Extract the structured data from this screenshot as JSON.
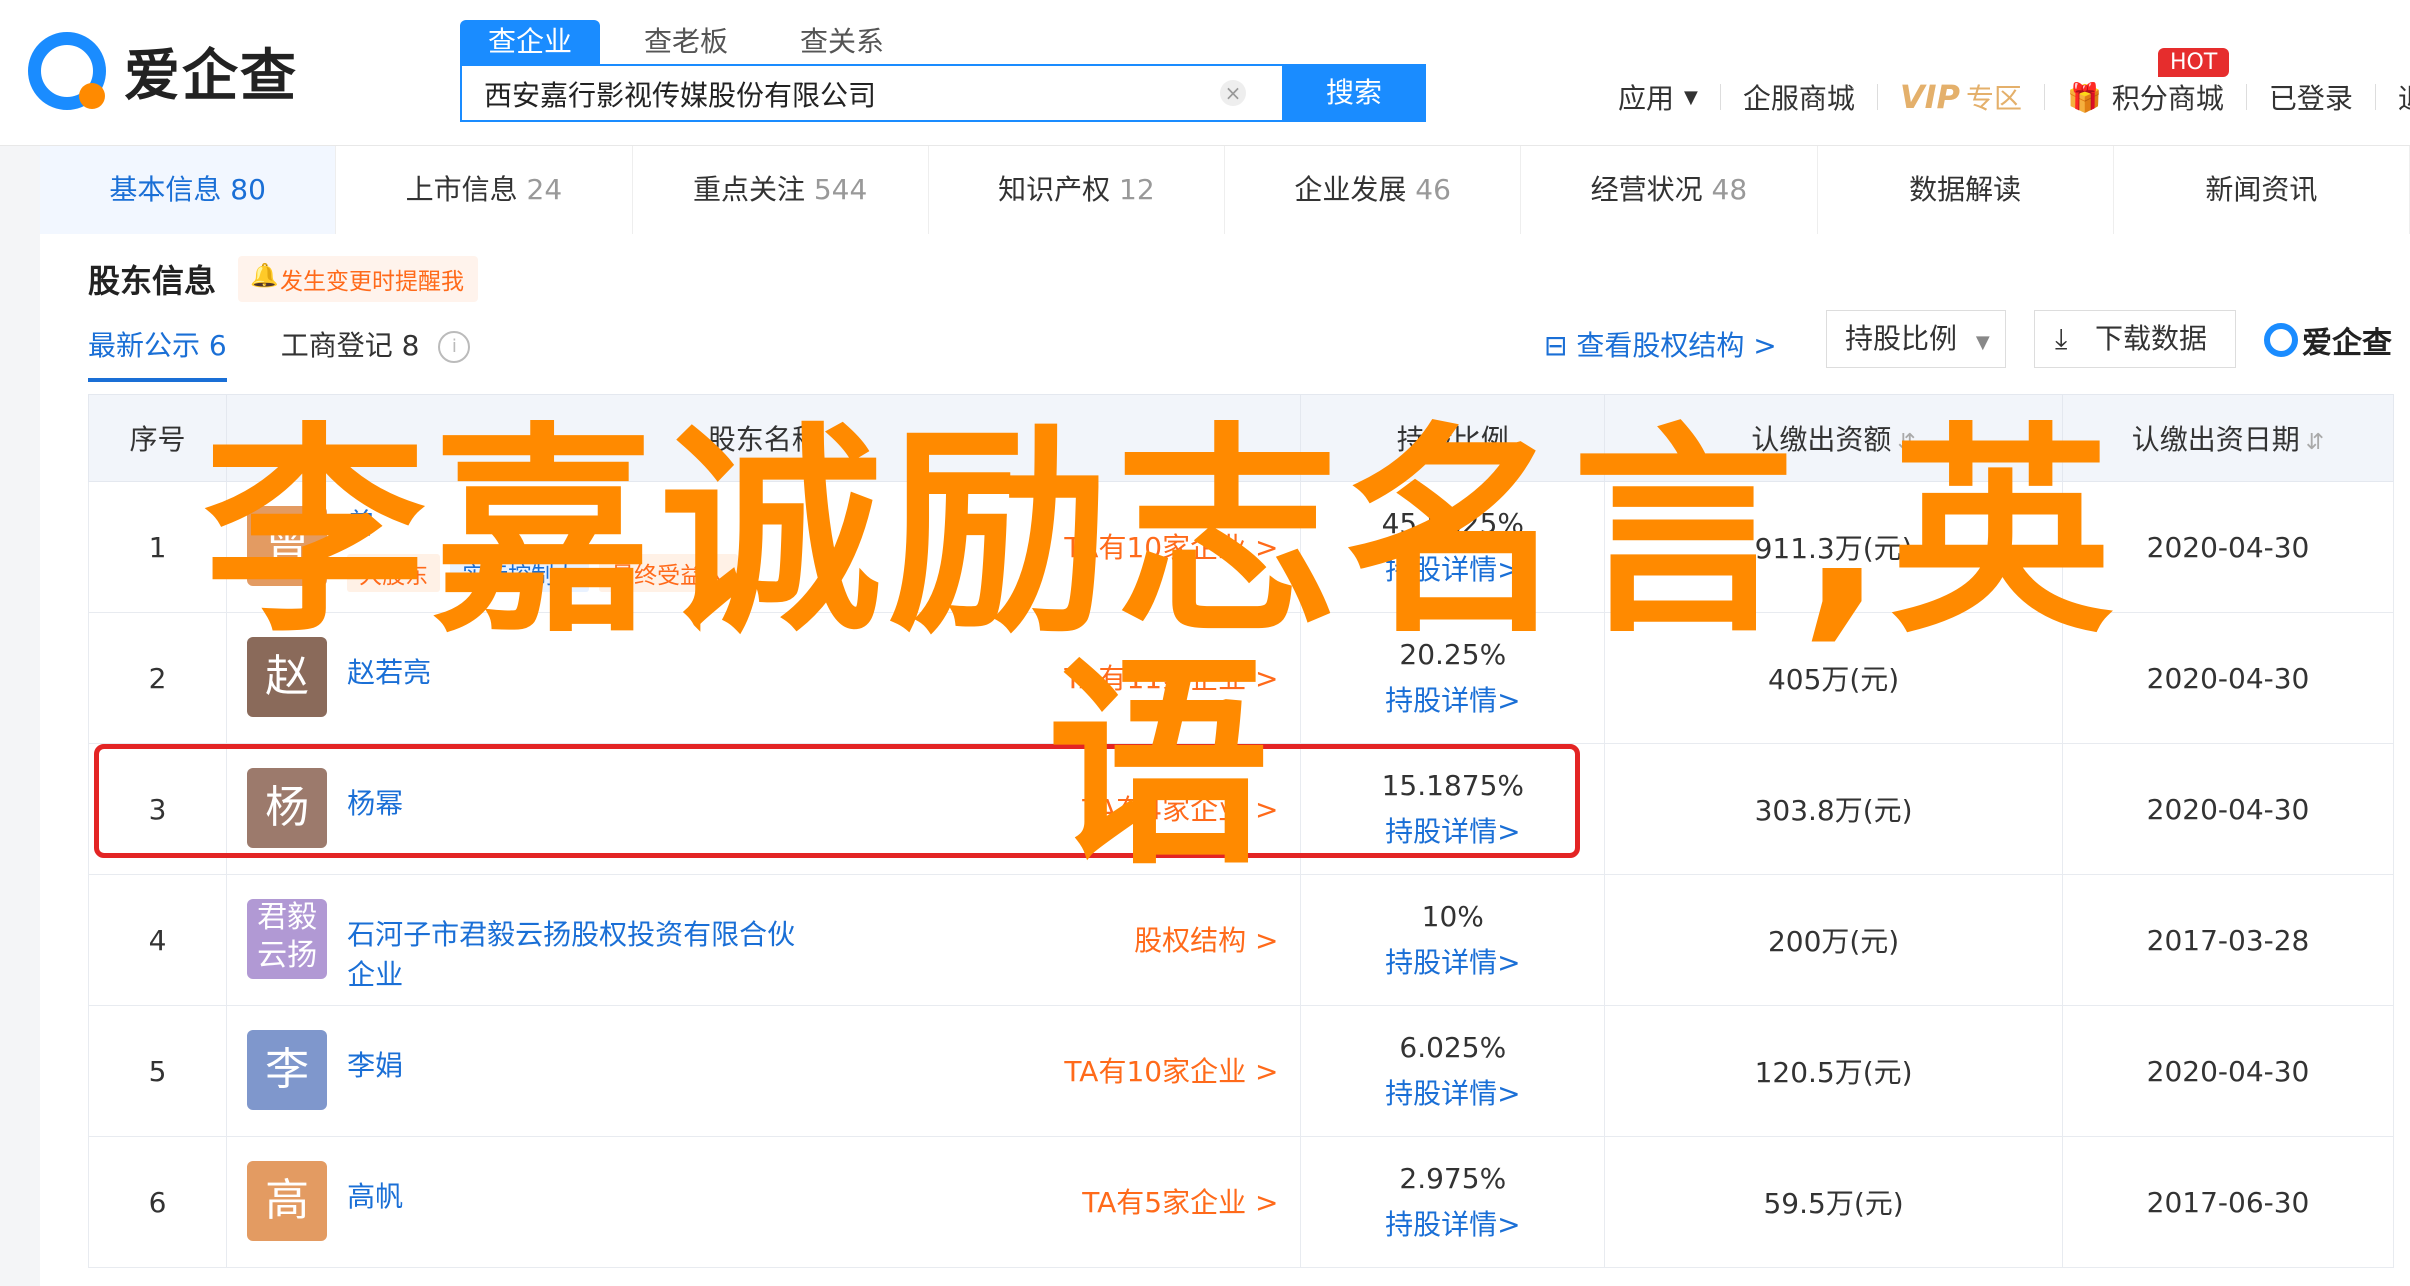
{
  "header": {
    "logo_text": "爱企查",
    "search_tabs": [
      "查企业",
      "查老板",
      "查关系"
    ],
    "search_value": "西安嘉行影视传媒股份有限公司",
    "clear_icon": "×",
    "search_button": "搜索",
    "nav": {
      "apps": "应用",
      "services": "企服商城",
      "vip": "VIP",
      "vip_zone": "专区",
      "points": "积分商城",
      "hot_badge": "HOT",
      "user": "已登录",
      "logout": "退出"
    }
  },
  "category_tabs": [
    {
      "label": "基本信息",
      "count": "80"
    },
    {
      "label": "上市信息",
      "count": "24"
    },
    {
      "label": "重点关注",
      "count": "544"
    },
    {
      "label": "知识产权",
      "count": "12"
    },
    {
      "label": "企业发展",
      "count": "46"
    },
    {
      "label": "经营状况",
      "count": "48"
    },
    {
      "label": "数据解读",
      "count": ""
    },
    {
      "label": "新闻资讯",
      "count": ""
    }
  ],
  "section": {
    "title": "股东信息",
    "alert": "发生变更时提醒我",
    "sub_tabs": [
      "最新公示 6",
      "工商登记 8"
    ],
    "info_icon": "i",
    "equity_link": "查看股权结构 >",
    "ratio_select": "持股比例",
    "download": "下载数据",
    "small_logo": "爱企查"
  },
  "table": {
    "headers": [
      "序号",
      "股东名称",
      "持股比例",
      "认缴出资额",
      "认缴出资日期"
    ],
    "rows": [
      {
        "no": "1",
        "avatar": "曾",
        "avatar_color": "#e39b62",
        "name": "曾",
        "tags": [
          "大股东",
          "实际控制人",
          "最终受益人"
        ],
        "firm": "TA有10家企业 >",
        "ratio": "45.5625%",
        "detail": "持股详情>",
        "amount": "911.3万(元)",
        "date": "2020-04-30"
      },
      {
        "no": "2",
        "avatar": "赵",
        "avatar_color": "#8a6a5a",
        "name": "赵若亮",
        "tags": [],
        "firm": "TA有11家企业 >",
        "ratio": "20.25%",
        "detail": "持股详情>",
        "amount": "405万(元)",
        "date": "2020-04-30"
      },
      {
        "no": "3",
        "avatar": "杨",
        "avatar_color": "#9c7a6c",
        "name": "杨幂",
        "tags": [],
        "firm": "TA有4家企业 >",
        "ratio": "15.1875%",
        "detail": "持股详情>",
        "amount": "303.8万(元)",
        "date": "2020-04-30"
      },
      {
        "no": "4",
        "avatar": "君毅云扬",
        "avatar_color": "#b199d4",
        "name": "石河子市君毅云扬股权投资有限合伙企业",
        "tags": [],
        "firm": "股权结构 >",
        "ratio": "10%",
        "detail": "持股详情>",
        "amount": "200万(元)",
        "date": "2017-03-28"
      },
      {
        "no": "5",
        "avatar": "李",
        "avatar_color": "#7f97cc",
        "name": "李娟",
        "tags": [],
        "firm": "TA有10家企业 >",
        "ratio": "6.025%",
        "detail": "持股详情>",
        "amount": "120.5万(元)",
        "date": "2020-04-30"
      },
      {
        "no": "6",
        "avatar": "高",
        "avatar_color": "#e39b62",
        "name": "高帆",
        "tags": [],
        "firm": "TA有5家企业 >",
        "ratio": "2.975%",
        "detail": "持股详情>",
        "amount": "59.5万(元)",
        "date": "2017-06-30"
      }
    ]
  },
  "overlay_title": "李嘉诚励志名言,英语"
}
